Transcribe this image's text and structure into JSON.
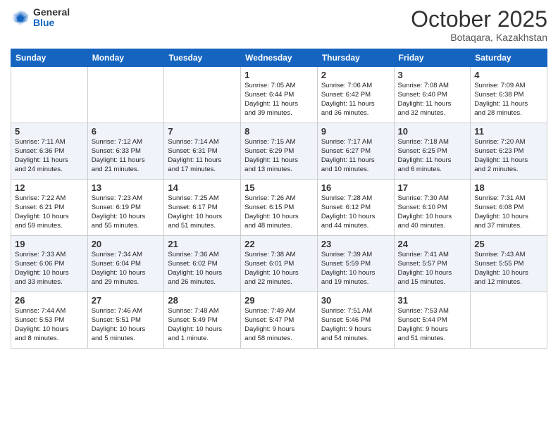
{
  "header": {
    "logo_general": "General",
    "logo_blue": "Blue",
    "month": "October 2025",
    "location": "Botaqara, Kazakhstan"
  },
  "weekdays": [
    "Sunday",
    "Monday",
    "Tuesday",
    "Wednesday",
    "Thursday",
    "Friday",
    "Saturday"
  ],
  "weeks": [
    [
      {
        "day": "",
        "info": ""
      },
      {
        "day": "",
        "info": ""
      },
      {
        "day": "",
        "info": ""
      },
      {
        "day": "1",
        "info": "Sunrise: 7:05 AM\nSunset: 6:44 PM\nDaylight: 11 hours\nand 39 minutes."
      },
      {
        "day": "2",
        "info": "Sunrise: 7:06 AM\nSunset: 6:42 PM\nDaylight: 11 hours\nand 36 minutes."
      },
      {
        "day": "3",
        "info": "Sunrise: 7:08 AM\nSunset: 6:40 PM\nDaylight: 11 hours\nand 32 minutes."
      },
      {
        "day": "4",
        "info": "Sunrise: 7:09 AM\nSunset: 6:38 PM\nDaylight: 11 hours\nand 28 minutes."
      }
    ],
    [
      {
        "day": "5",
        "info": "Sunrise: 7:11 AM\nSunset: 6:36 PM\nDaylight: 11 hours\nand 24 minutes."
      },
      {
        "day": "6",
        "info": "Sunrise: 7:12 AM\nSunset: 6:33 PM\nDaylight: 11 hours\nand 21 minutes."
      },
      {
        "day": "7",
        "info": "Sunrise: 7:14 AM\nSunset: 6:31 PM\nDaylight: 11 hours\nand 17 minutes."
      },
      {
        "day": "8",
        "info": "Sunrise: 7:15 AM\nSunset: 6:29 PM\nDaylight: 11 hours\nand 13 minutes."
      },
      {
        "day": "9",
        "info": "Sunrise: 7:17 AM\nSunset: 6:27 PM\nDaylight: 11 hours\nand 10 minutes."
      },
      {
        "day": "10",
        "info": "Sunrise: 7:18 AM\nSunset: 6:25 PM\nDaylight: 11 hours\nand 6 minutes."
      },
      {
        "day": "11",
        "info": "Sunrise: 7:20 AM\nSunset: 6:23 PM\nDaylight: 11 hours\nand 2 minutes."
      }
    ],
    [
      {
        "day": "12",
        "info": "Sunrise: 7:22 AM\nSunset: 6:21 PM\nDaylight: 10 hours\nand 59 minutes."
      },
      {
        "day": "13",
        "info": "Sunrise: 7:23 AM\nSunset: 6:19 PM\nDaylight: 10 hours\nand 55 minutes."
      },
      {
        "day": "14",
        "info": "Sunrise: 7:25 AM\nSunset: 6:17 PM\nDaylight: 10 hours\nand 51 minutes."
      },
      {
        "day": "15",
        "info": "Sunrise: 7:26 AM\nSunset: 6:15 PM\nDaylight: 10 hours\nand 48 minutes."
      },
      {
        "day": "16",
        "info": "Sunrise: 7:28 AM\nSunset: 6:12 PM\nDaylight: 10 hours\nand 44 minutes."
      },
      {
        "day": "17",
        "info": "Sunrise: 7:30 AM\nSunset: 6:10 PM\nDaylight: 10 hours\nand 40 minutes."
      },
      {
        "day": "18",
        "info": "Sunrise: 7:31 AM\nSunset: 6:08 PM\nDaylight: 10 hours\nand 37 minutes."
      }
    ],
    [
      {
        "day": "19",
        "info": "Sunrise: 7:33 AM\nSunset: 6:06 PM\nDaylight: 10 hours\nand 33 minutes."
      },
      {
        "day": "20",
        "info": "Sunrise: 7:34 AM\nSunset: 6:04 PM\nDaylight: 10 hours\nand 29 minutes."
      },
      {
        "day": "21",
        "info": "Sunrise: 7:36 AM\nSunset: 6:02 PM\nDaylight: 10 hours\nand 26 minutes."
      },
      {
        "day": "22",
        "info": "Sunrise: 7:38 AM\nSunset: 6:01 PM\nDaylight: 10 hours\nand 22 minutes."
      },
      {
        "day": "23",
        "info": "Sunrise: 7:39 AM\nSunset: 5:59 PM\nDaylight: 10 hours\nand 19 minutes."
      },
      {
        "day": "24",
        "info": "Sunrise: 7:41 AM\nSunset: 5:57 PM\nDaylight: 10 hours\nand 15 minutes."
      },
      {
        "day": "25",
        "info": "Sunrise: 7:43 AM\nSunset: 5:55 PM\nDaylight: 10 hours\nand 12 minutes."
      }
    ],
    [
      {
        "day": "26",
        "info": "Sunrise: 7:44 AM\nSunset: 5:53 PM\nDaylight: 10 hours\nand 8 minutes."
      },
      {
        "day": "27",
        "info": "Sunrise: 7:46 AM\nSunset: 5:51 PM\nDaylight: 10 hours\nand 5 minutes."
      },
      {
        "day": "28",
        "info": "Sunrise: 7:48 AM\nSunset: 5:49 PM\nDaylight: 10 hours\nand 1 minute."
      },
      {
        "day": "29",
        "info": "Sunrise: 7:49 AM\nSunset: 5:47 PM\nDaylight: 9 hours\nand 58 minutes."
      },
      {
        "day": "30",
        "info": "Sunrise: 7:51 AM\nSunset: 5:46 PM\nDaylight: 9 hours\nand 54 minutes."
      },
      {
        "day": "31",
        "info": "Sunrise: 7:53 AM\nSunset: 5:44 PM\nDaylight: 9 hours\nand 51 minutes."
      },
      {
        "day": "",
        "info": ""
      }
    ]
  ]
}
